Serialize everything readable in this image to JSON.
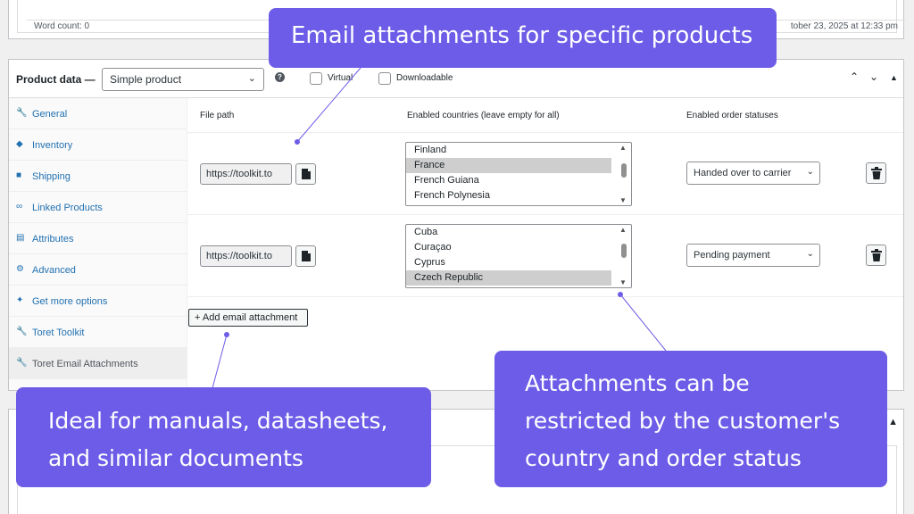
{
  "editor": {
    "word_count": "Word count: 0",
    "timestamp": "tober 23, 2025 at 12:33 pm"
  },
  "product_data": {
    "title": "Product data —",
    "product_type": "Simple product",
    "help": "?",
    "virtual_label": "Virtual",
    "downloadable_label": "Downloadable",
    "tabs": [
      {
        "label": "General",
        "icon": "wrench-icon"
      },
      {
        "label": "Inventory",
        "icon": "tag-icon"
      },
      {
        "label": "Shipping",
        "icon": "truck-icon"
      },
      {
        "label": "Linked Products",
        "icon": "link-icon"
      },
      {
        "label": "Attributes",
        "icon": "list-icon"
      },
      {
        "label": "Advanced",
        "icon": "gear-icon"
      },
      {
        "label": "Get more options",
        "icon": "plugin-icon"
      },
      {
        "label": "Toret Toolkit",
        "icon": "wrench-icon"
      },
      {
        "label": "Toret Email Attachments",
        "icon": "wrench-icon"
      }
    ],
    "columns": {
      "file_path": "File path",
      "countries": "Enabled countries (leave empty for all)",
      "statuses": "Enabled order statuses"
    },
    "rows": [
      {
        "file_path": "https://toolkit.to",
        "countries": [
          {
            "name": "Finland",
            "selected": false
          },
          {
            "name": "France",
            "selected": true
          },
          {
            "name": "French Guiana",
            "selected": false
          },
          {
            "name": "French Polynesia",
            "selected": false
          }
        ],
        "status": "Handed over to carrier"
      },
      {
        "file_path": "https://toolkit.to",
        "countries": [
          {
            "name": "Cuba",
            "selected": false
          },
          {
            "name": "Curaçao",
            "selected": false
          },
          {
            "name": "Cyprus",
            "selected": false
          },
          {
            "name": "Czech Republic",
            "selected": true
          }
        ],
        "status": "Pending payment"
      }
    ],
    "add_button": "+ Add email attachment"
  },
  "callouts": {
    "top": "Email attachments for specific products",
    "left": [
      "Ideal for manuals, datasheets,",
      "and similar documents"
    ],
    "right": [
      "Attachments can be",
      "restricted by the customer's",
      "country and order status"
    ]
  },
  "colors": {
    "callout": "#6c5ce7",
    "link": "#2271b1"
  }
}
